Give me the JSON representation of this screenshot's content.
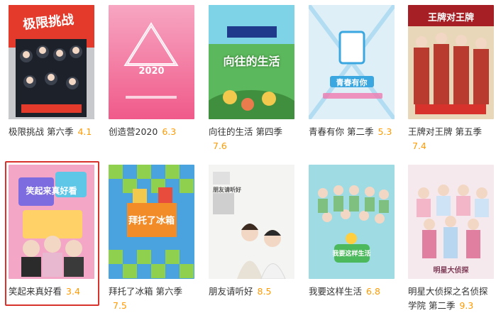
{
  "shows": [
    {
      "title": "极限挑战 第六季",
      "score": "4.1",
      "poster_text": "极限挑战"
    },
    {
      "title": "创造营2020",
      "score": "6.3",
      "poster_text": "2020"
    },
    {
      "title": "向往的生活 第四季",
      "score": "7.6",
      "poster_text": "向往的生活"
    },
    {
      "title": "青春有你 第二季",
      "score": "5.3",
      "poster_text": "青春有你"
    },
    {
      "title": "王牌对王牌 第五季",
      "score": "7.4",
      "poster_text": "王牌对王牌"
    },
    {
      "title": "笑起来真好看",
      "score": "3.4",
      "poster_text": "笑起来真好看"
    },
    {
      "title": "拜托了冰箱 第六季",
      "score": "7.5",
      "poster_text": "拜托了冰箱"
    },
    {
      "title": "朋友请听好",
      "score": "8.5",
      "poster_text": "朋友请听好"
    },
    {
      "title": "我要这样生活",
      "score": "6.8",
      "poster_text": "我要这样生活"
    },
    {
      "title": "明星大侦探之名侦探学院 第二季",
      "score": "9.3",
      "poster_text": "明星大侦探"
    }
  ],
  "colors": {
    "score": "#ff9a00",
    "selection_border": "#d8322c",
    "text": "#333333"
  }
}
